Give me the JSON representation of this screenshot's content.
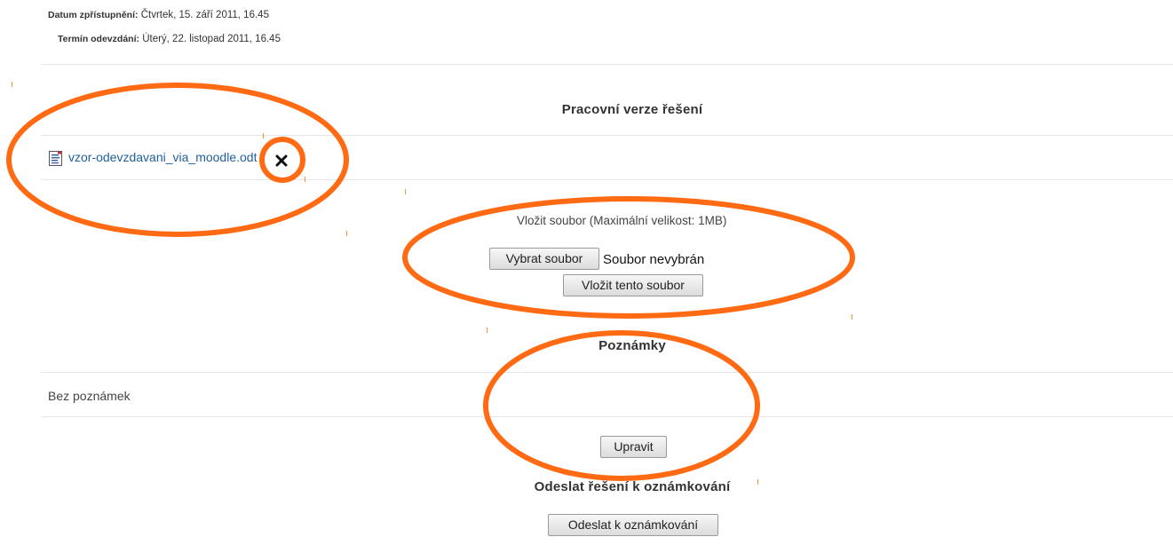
{
  "dates": {
    "available_label": "Datum zpřístupnění:",
    "available_value": "Čtvrtek, 15. září 2011, 16.45",
    "due_label": "Termín odevzdání:",
    "due_value": "Úterý, 22. listopad 2011, 16.45"
  },
  "draft": {
    "heading": "Pracovní verze řešení",
    "file_name": "vzor-odevzdavani_via_moodle.odt",
    "file_icon": "document-icon",
    "delete_icon": "close-icon"
  },
  "upload": {
    "title": "Vložit soubor (Maximální velikost: 1MB)",
    "choose_button": "Vybrat soubor",
    "no_file_text": "Soubor nevybrán",
    "submit_button": "Vložit tento soubor"
  },
  "notes": {
    "heading": "Poznámky",
    "empty_text": "Bez poznámek",
    "edit_button": "Upravit"
  },
  "submit": {
    "heading": "Odeslat řešení k oznámkování",
    "button": "Odeslat k oznámkování"
  },
  "annotation_color": "#ff6a13"
}
